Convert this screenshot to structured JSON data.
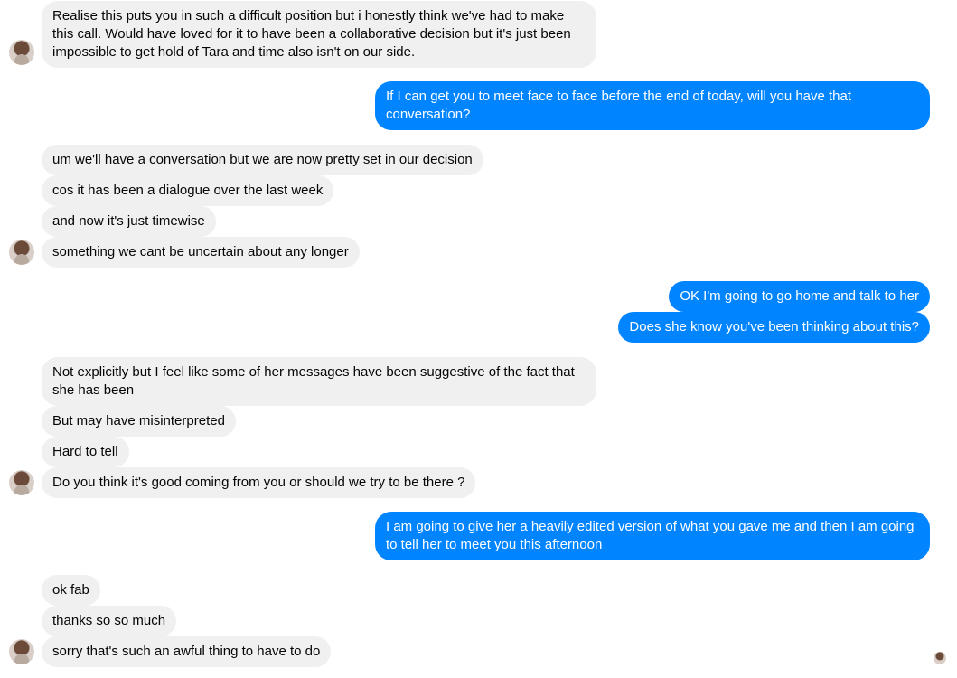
{
  "messages": [
    {
      "id": "m1",
      "side": "in",
      "text": "Realise this puts you in such a difficult position but i honestly think we've had to make this call. Would have loved for it to have been a collaborative decision but it's just been impossible to get hold of Tara and time also isn't on our side."
    },
    {
      "id": "m2",
      "side": "out",
      "text": "If I can get you to meet face to face before the end of today, will you have that conversation?"
    },
    {
      "id": "m3",
      "side": "in",
      "text": "um we'll have a conversation but we are now pretty set in our decision"
    },
    {
      "id": "m4",
      "side": "in",
      "text": "cos it has been a dialogue over the last week"
    },
    {
      "id": "m5",
      "side": "in",
      "text": "and now it's just timewise"
    },
    {
      "id": "m6",
      "side": "in",
      "text": "something we cant be uncertain about any longer"
    },
    {
      "id": "m7",
      "side": "out",
      "text": "OK I'm going to go home and talk to her"
    },
    {
      "id": "m8",
      "side": "out",
      "text": "Does she know you've been thinking about this?"
    },
    {
      "id": "m9",
      "side": "in",
      "text": "Not explicitly but I feel like some of her messages have been suggestive of the fact that she has been"
    },
    {
      "id": "m10",
      "side": "in",
      "text": "But may have misinterpreted"
    },
    {
      "id": "m11",
      "side": "in",
      "text": "Hard to tell"
    },
    {
      "id": "m12",
      "side": "in",
      "text": "Do you think it's good coming from you or should we try to be there ?"
    },
    {
      "id": "m13",
      "side": "out",
      "text": "I am going to give her a heavily edited version of what you gave me and then I am going to tell her to meet you this afternoon"
    },
    {
      "id": "m14",
      "side": "in",
      "text": "ok fab"
    },
    {
      "id": "m15",
      "side": "in",
      "text": "thanks so so much"
    },
    {
      "id": "m16",
      "side": "in",
      "text": "sorry that's such an awful thing to have to do"
    }
  ],
  "colors": {
    "incoming_bubble": "#f0f0f0",
    "outgoing_bubble": "#0084ff",
    "outgoing_text": "#ffffff"
  }
}
